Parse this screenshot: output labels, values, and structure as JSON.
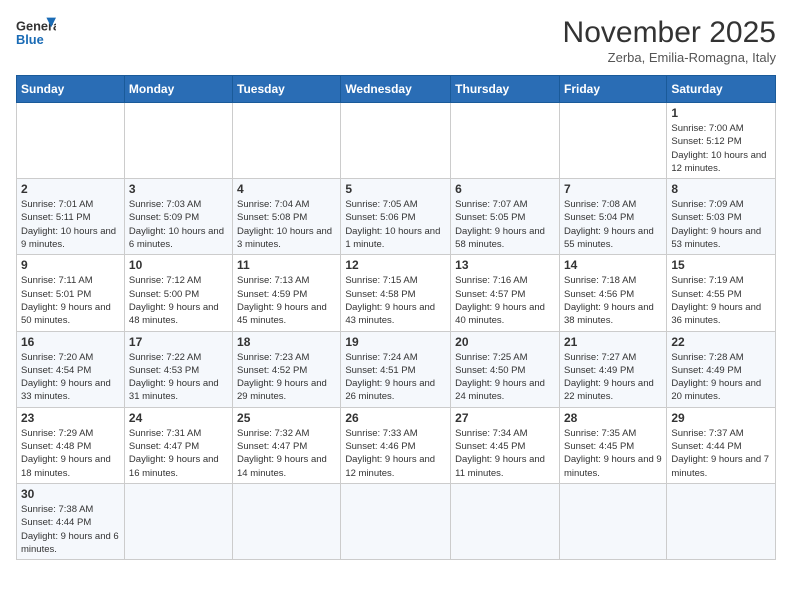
{
  "header": {
    "logo_general": "General",
    "logo_blue": "Blue",
    "month_title": "November 2025",
    "subtitle": "Zerba, Emilia-Romagna, Italy"
  },
  "days_of_week": [
    "Sunday",
    "Monday",
    "Tuesday",
    "Wednesday",
    "Thursday",
    "Friday",
    "Saturday"
  ],
  "weeks": [
    [
      {
        "day": "",
        "info": ""
      },
      {
        "day": "",
        "info": ""
      },
      {
        "day": "",
        "info": ""
      },
      {
        "day": "",
        "info": ""
      },
      {
        "day": "",
        "info": ""
      },
      {
        "day": "",
        "info": ""
      },
      {
        "day": "1",
        "info": "Sunrise: 7:00 AM\nSunset: 5:12 PM\nDaylight: 10 hours and 12 minutes."
      }
    ],
    [
      {
        "day": "2",
        "info": "Sunrise: 7:01 AM\nSunset: 5:11 PM\nDaylight: 10 hours and 9 minutes."
      },
      {
        "day": "3",
        "info": "Sunrise: 7:03 AM\nSunset: 5:09 PM\nDaylight: 10 hours and 6 minutes."
      },
      {
        "day": "4",
        "info": "Sunrise: 7:04 AM\nSunset: 5:08 PM\nDaylight: 10 hours and 3 minutes."
      },
      {
        "day": "5",
        "info": "Sunrise: 7:05 AM\nSunset: 5:06 PM\nDaylight: 10 hours and 1 minute."
      },
      {
        "day": "6",
        "info": "Sunrise: 7:07 AM\nSunset: 5:05 PM\nDaylight: 9 hours and 58 minutes."
      },
      {
        "day": "7",
        "info": "Sunrise: 7:08 AM\nSunset: 5:04 PM\nDaylight: 9 hours and 55 minutes."
      },
      {
        "day": "8",
        "info": "Sunrise: 7:09 AM\nSunset: 5:03 PM\nDaylight: 9 hours and 53 minutes."
      }
    ],
    [
      {
        "day": "9",
        "info": "Sunrise: 7:11 AM\nSunset: 5:01 PM\nDaylight: 9 hours and 50 minutes."
      },
      {
        "day": "10",
        "info": "Sunrise: 7:12 AM\nSunset: 5:00 PM\nDaylight: 9 hours and 48 minutes."
      },
      {
        "day": "11",
        "info": "Sunrise: 7:13 AM\nSunset: 4:59 PM\nDaylight: 9 hours and 45 minutes."
      },
      {
        "day": "12",
        "info": "Sunrise: 7:15 AM\nSunset: 4:58 PM\nDaylight: 9 hours and 43 minutes."
      },
      {
        "day": "13",
        "info": "Sunrise: 7:16 AM\nSunset: 4:57 PM\nDaylight: 9 hours and 40 minutes."
      },
      {
        "day": "14",
        "info": "Sunrise: 7:18 AM\nSunset: 4:56 PM\nDaylight: 9 hours and 38 minutes."
      },
      {
        "day": "15",
        "info": "Sunrise: 7:19 AM\nSunset: 4:55 PM\nDaylight: 9 hours and 36 minutes."
      }
    ],
    [
      {
        "day": "16",
        "info": "Sunrise: 7:20 AM\nSunset: 4:54 PM\nDaylight: 9 hours and 33 minutes."
      },
      {
        "day": "17",
        "info": "Sunrise: 7:22 AM\nSunset: 4:53 PM\nDaylight: 9 hours and 31 minutes."
      },
      {
        "day": "18",
        "info": "Sunrise: 7:23 AM\nSunset: 4:52 PM\nDaylight: 9 hours and 29 minutes."
      },
      {
        "day": "19",
        "info": "Sunrise: 7:24 AM\nSunset: 4:51 PM\nDaylight: 9 hours and 26 minutes."
      },
      {
        "day": "20",
        "info": "Sunrise: 7:25 AM\nSunset: 4:50 PM\nDaylight: 9 hours and 24 minutes."
      },
      {
        "day": "21",
        "info": "Sunrise: 7:27 AM\nSunset: 4:49 PM\nDaylight: 9 hours and 22 minutes."
      },
      {
        "day": "22",
        "info": "Sunrise: 7:28 AM\nSunset: 4:49 PM\nDaylight: 9 hours and 20 minutes."
      }
    ],
    [
      {
        "day": "23",
        "info": "Sunrise: 7:29 AM\nSunset: 4:48 PM\nDaylight: 9 hours and 18 minutes."
      },
      {
        "day": "24",
        "info": "Sunrise: 7:31 AM\nSunset: 4:47 PM\nDaylight: 9 hours and 16 minutes."
      },
      {
        "day": "25",
        "info": "Sunrise: 7:32 AM\nSunset: 4:47 PM\nDaylight: 9 hours and 14 minutes."
      },
      {
        "day": "26",
        "info": "Sunrise: 7:33 AM\nSunset: 4:46 PM\nDaylight: 9 hours and 12 minutes."
      },
      {
        "day": "27",
        "info": "Sunrise: 7:34 AM\nSunset: 4:45 PM\nDaylight: 9 hours and 11 minutes."
      },
      {
        "day": "28",
        "info": "Sunrise: 7:35 AM\nSunset: 4:45 PM\nDaylight: 9 hours and 9 minutes."
      },
      {
        "day": "29",
        "info": "Sunrise: 7:37 AM\nSunset: 4:44 PM\nDaylight: 9 hours and 7 minutes."
      }
    ],
    [
      {
        "day": "30",
        "info": "Sunrise: 7:38 AM\nSunset: 4:44 PM\nDaylight: 9 hours and 6 minutes."
      },
      {
        "day": "",
        "info": ""
      },
      {
        "day": "",
        "info": ""
      },
      {
        "day": "",
        "info": ""
      },
      {
        "day": "",
        "info": ""
      },
      {
        "day": "",
        "info": ""
      },
      {
        "day": "",
        "info": ""
      }
    ]
  ]
}
